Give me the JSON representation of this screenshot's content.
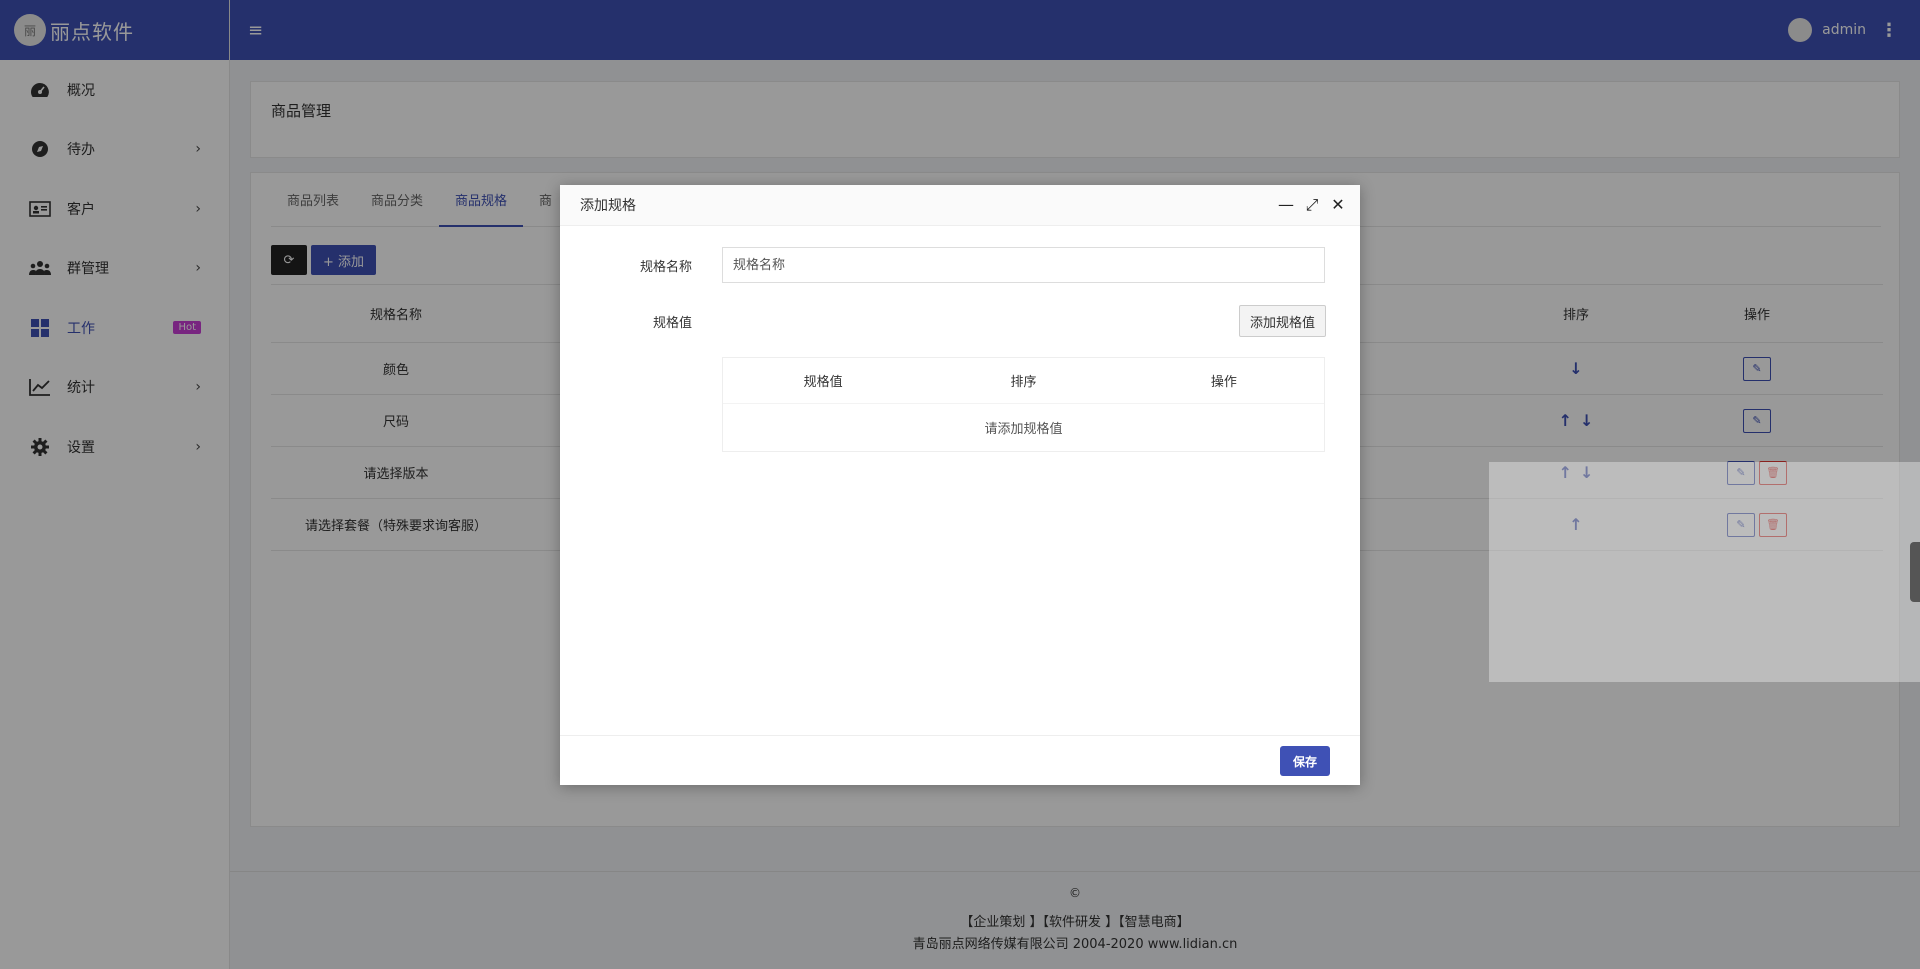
{
  "brand": {
    "logo_text": "丽",
    "name": "丽点软件"
  },
  "sidebar": {
    "items": [
      {
        "label": "概况",
        "icon": "dashboard-icon",
        "has_chevron": false
      },
      {
        "label": "待办",
        "icon": "compass-icon",
        "has_chevron": true
      },
      {
        "label": "客户",
        "icon": "id-card-icon",
        "has_chevron": true
      },
      {
        "label": "群管理",
        "icon": "users-icon",
        "has_chevron": true
      },
      {
        "label": "工作",
        "icon": "grid-icon",
        "badge": "Hot",
        "active": true
      },
      {
        "label": "统计",
        "icon": "line-chart-icon",
        "has_chevron": true
      },
      {
        "label": "设置",
        "icon": "gear-icon",
        "has_chevron": true
      }
    ],
    "chevron": "›"
  },
  "topbar": {
    "menu_icon": "≡",
    "username": "admin",
    "more_icon": "⋮"
  },
  "page": {
    "title": "商品管理"
  },
  "tabs": [
    "商品列表",
    "商品分类",
    "商品规格",
    "商"
  ],
  "toolbar": {
    "refresh_icon": "⟳",
    "add_label": "+ 添加"
  },
  "spec_table": {
    "headers": [
      "规格名称",
      "",
      "排序",
      "操作"
    ],
    "rows": [
      {
        "name": "颜色",
        "up": false,
        "down": true,
        "delete": false
      },
      {
        "name": "尺码",
        "up": true,
        "down": true,
        "delete": false
      },
      {
        "name": "请选择版本",
        "up": true,
        "down": true,
        "delete": true
      },
      {
        "name": "请选择套餐（特殊要求询客服）",
        "up": true,
        "down": false,
        "delete": true
      }
    ],
    "up_arrow": "↑",
    "down_arrow": "↓",
    "edit_icon": "✎",
    "delete_icon": "🗑"
  },
  "footer": {
    "copyright": "©",
    "links": "【企业策划 】【软件研发 】【智慧电商】",
    "company": "青岛丽点网络传媒有限公司 2004-2020 www.lidian.cn"
  },
  "modal": {
    "title": "添加规格",
    "minimize_icon": "—",
    "maximize_icon": "⤢",
    "close_icon": "✕",
    "name_label": "规格名称",
    "name_placeholder": "规格名称",
    "value_label": "规格值",
    "add_value_button": "添加规格值",
    "value_table_headers": [
      "规格值",
      "排序",
      "操作"
    ],
    "empty_text": "请添加规格值",
    "save_button": "保存"
  },
  "colors": {
    "primary": "#3f51b5",
    "hot_badge": "#c93fd6",
    "danger": "#e53935"
  }
}
